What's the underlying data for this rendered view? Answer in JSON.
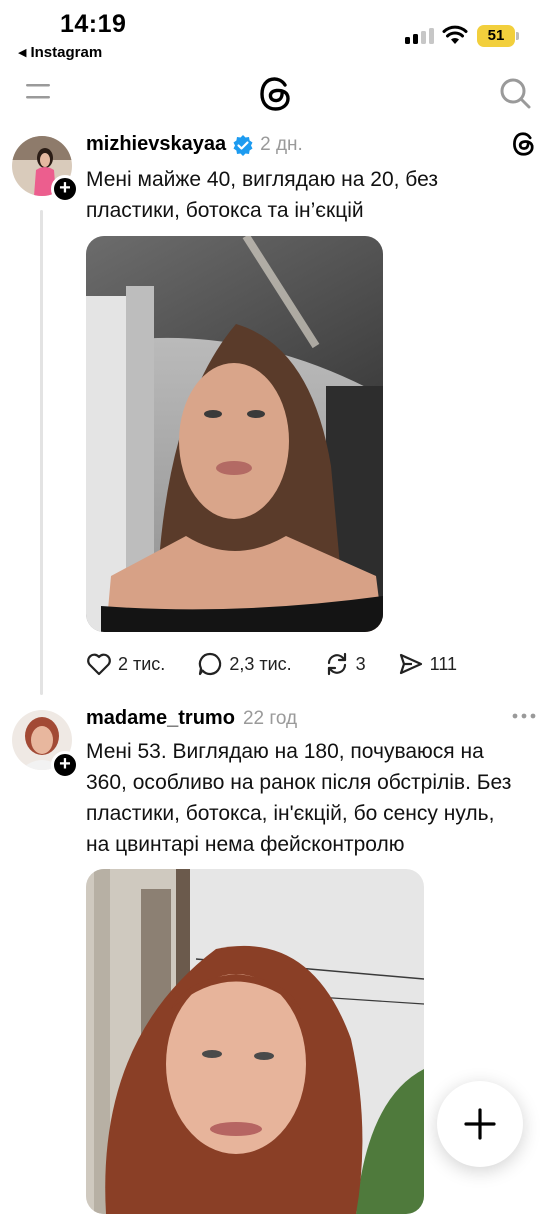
{
  "status_bar": {
    "time": "14:19",
    "back_app": "Instagram",
    "battery": "51"
  },
  "header": {
    "menu_icon": "hamburger-icon",
    "logo_icon": "threads-logo-icon",
    "search_icon": "search-icon"
  },
  "posts": [
    {
      "username": "mizhievskayaa",
      "verified": true,
      "time": "2 дн.",
      "text_lines": [
        "Мені майже 40, виглядаю на 20, без",
        "пластики, ботокса та ін’єкцій"
      ],
      "likes": "2 тис.",
      "replies": "2,3 тис.",
      "reposts": "3",
      "shares": "111"
    },
    {
      "username": "madame_trumo",
      "verified": false,
      "time": "22 год",
      "text_lines": [
        "Мені 53. Виглядаю на 180, почуваюся на",
        "360, особливо на ранок після обстрілів. Без",
        "пластики, ботокса, ін'єкцій, бо сенсу нуль,",
        "на цвинтарі нема фейсконтролю"
      ]
    }
  ],
  "colors": {
    "battery": "#f2cf3c",
    "verified": "#1d9bf0",
    "muted": "#9a9a9a"
  }
}
